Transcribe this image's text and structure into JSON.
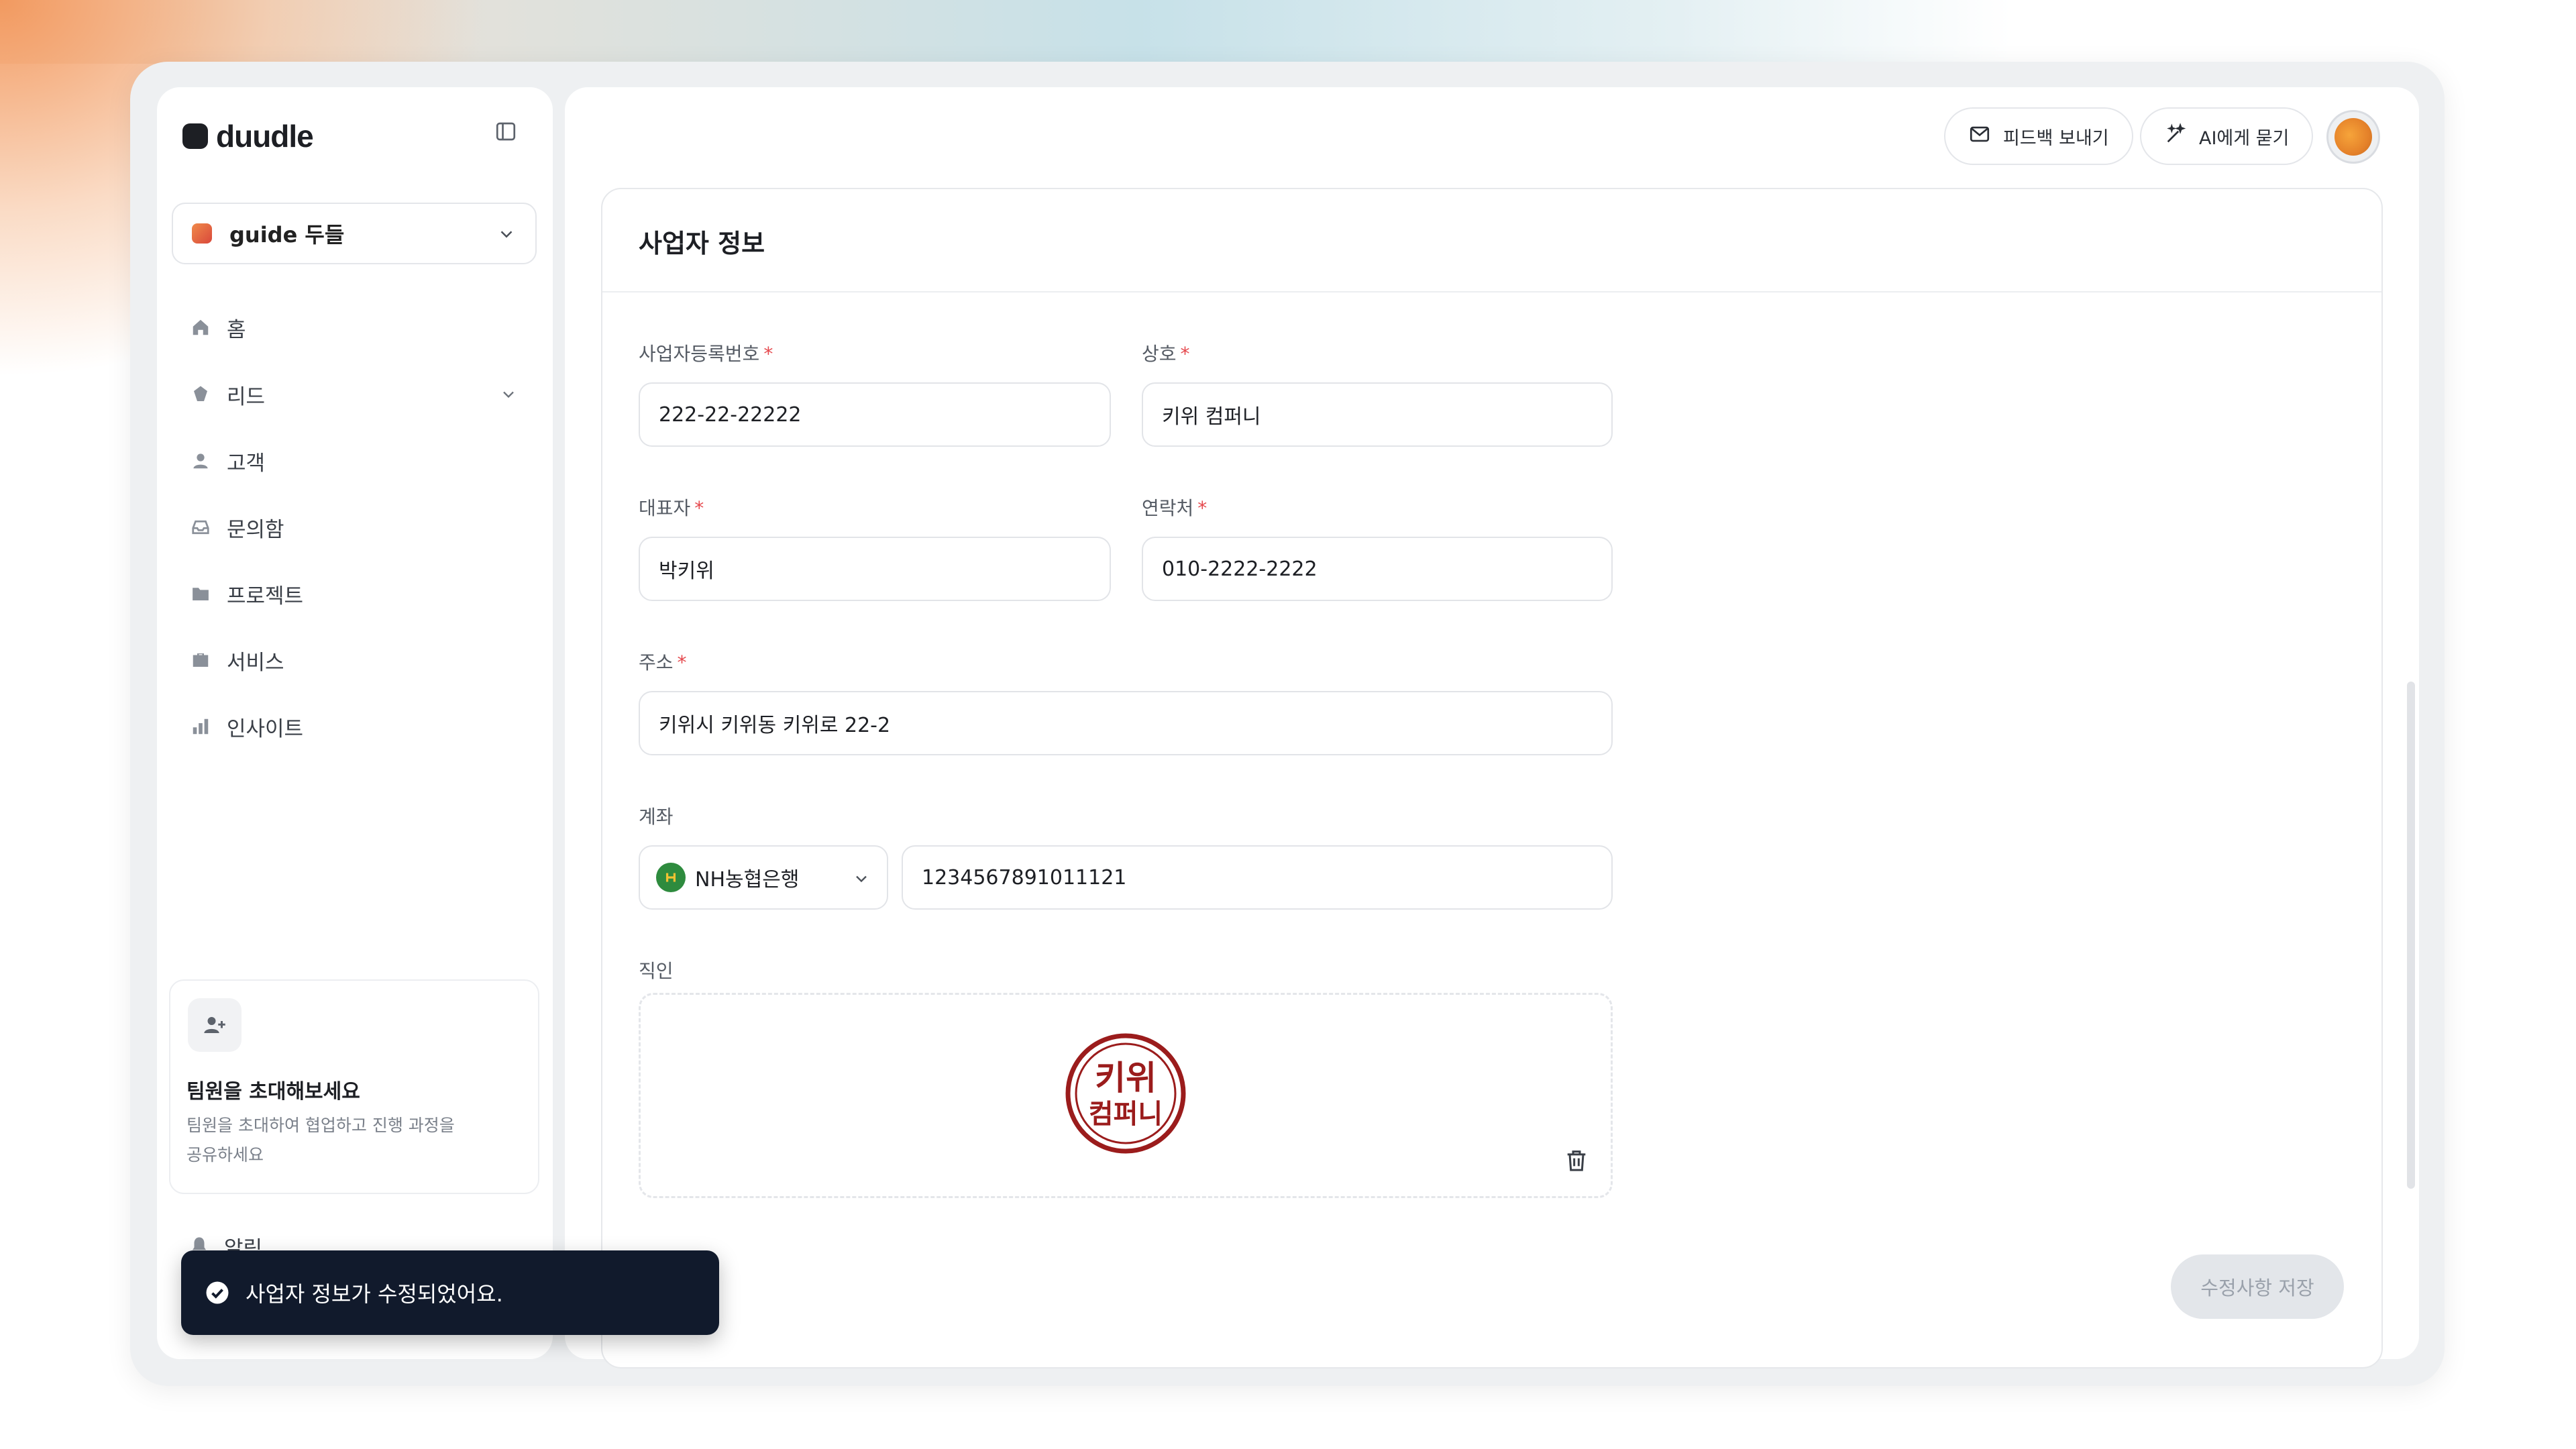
{
  "app": {
    "logo_text": "duudle"
  },
  "sidebar": {
    "workspace": "guide 두들",
    "items": [
      {
        "label": "홈",
        "icon": "home-icon"
      },
      {
        "label": "리드",
        "icon": "lead-icon",
        "has_chevron": true
      },
      {
        "label": "고객",
        "icon": "person-icon"
      },
      {
        "label": "문의함",
        "icon": "inbox-icon"
      },
      {
        "label": "프로젝트",
        "icon": "folder-icon"
      },
      {
        "label": "서비스",
        "icon": "briefcase-icon"
      },
      {
        "label": "인사이트",
        "icon": "bar-chart-icon"
      }
    ],
    "invite": {
      "title": "팀원을 초대해보세요",
      "description": "팀원을 초대하여 협업하고 진행 과정을 공유하세요"
    },
    "alarm_label": "알림"
  },
  "header": {
    "feedback_label": "피드백 보내기",
    "ai_label": "AI에게 묻기"
  },
  "form": {
    "title": "사업자 정보",
    "fields": {
      "biz_number": {
        "label": "사업자등록번호",
        "required": "*",
        "value": "222-22-22222"
      },
      "company": {
        "label": "상호",
        "required": "*",
        "value": "키위 컴퍼니"
      },
      "ceo": {
        "label": "대표자",
        "required": "*",
        "value": "박키위"
      },
      "phone": {
        "label": "연락처",
        "required": "*",
        "value": "010-2222-2222"
      },
      "address": {
        "label": "주소",
        "required": "*",
        "value": "키위시 키위동 키위로 22-2"
      },
      "account": {
        "label": "계좌",
        "bank": "NH농협은행",
        "number": "1234567891011121"
      },
      "seal": {
        "label": "직인",
        "seal_line1": "키위",
        "seal_line2": "컴퍼니"
      }
    },
    "save_label": "수정사항 저장"
  },
  "toast": {
    "message": "사업자 정보가 수정되었어요."
  },
  "colors": {
    "accent": "#111a2c",
    "required": "#e5484d",
    "seal": "#9b1c1c",
    "bank": "#2e8b3e"
  }
}
